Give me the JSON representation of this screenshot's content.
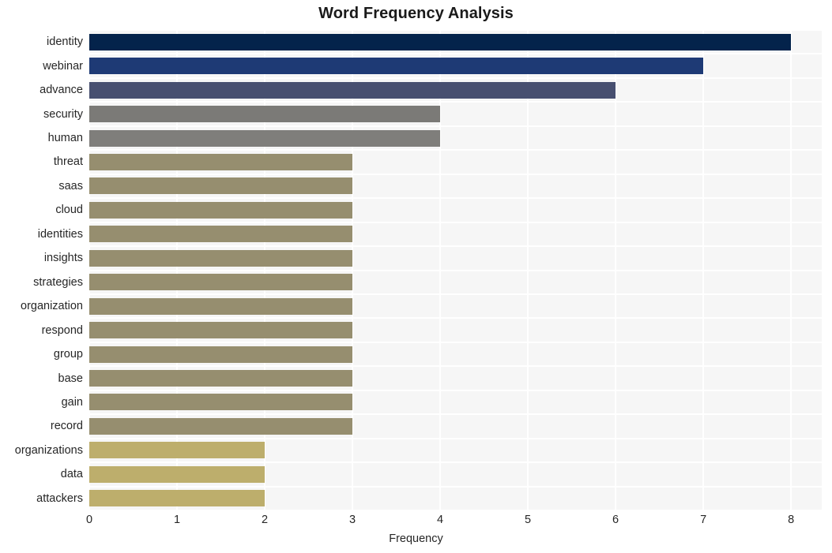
{
  "chart_data": {
    "type": "bar",
    "orientation": "horizontal",
    "title": "Word Frequency Analysis",
    "xlabel": "Frequency",
    "ylabel": "",
    "xlim": [
      0,
      8.35
    ],
    "xticks": [
      0,
      1,
      2,
      3,
      4,
      5,
      6,
      7,
      8
    ],
    "xtick_labels": [
      "0",
      "1",
      "2",
      "3",
      "4",
      "5",
      "6",
      "7",
      "8"
    ],
    "grid": true,
    "grid_color": "#ffffff",
    "plot_background": "#f6f6f6",
    "legend": null,
    "categories": [
      "identity",
      "webinar",
      "advance",
      "security",
      "human",
      "threat",
      "saas",
      "cloud",
      "identities",
      "insights",
      "strategies",
      "organization",
      "respond",
      "group",
      "base",
      "gain",
      "record",
      "organizations",
      "data",
      "attackers"
    ],
    "values": [
      8,
      7,
      6,
      4,
      4,
      3,
      3,
      3,
      3,
      3,
      3,
      3,
      3,
      3,
      3,
      3,
      3,
      2,
      2,
      2
    ],
    "bar_colors": [
      "#04234b",
      "#1e3a75",
      "#474f70",
      "#7b7a77",
      "#7f7e7b",
      "#968e6f",
      "#968e6f",
      "#968e6f",
      "#968e6f",
      "#968e6f",
      "#968e6f",
      "#968e6f",
      "#968e6f",
      "#968e6f",
      "#968e6f",
      "#968e6f",
      "#968e6f",
      "#bdae6c",
      "#bdae6c",
      "#bdae6c"
    ]
  }
}
